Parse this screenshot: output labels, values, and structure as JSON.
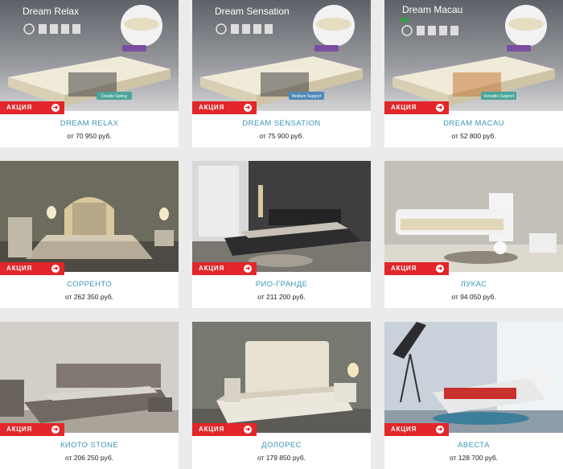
{
  "badge_label": "АКЦИЯ",
  "badge_arrow": "➜",
  "products": [
    {
      "name": "DREAM RELAX",
      "price": "от 70 950 руб.",
      "image_caption": "Dream Relax",
      "image_tag": "Double Spring"
    },
    {
      "name": "DREAM SENSATION",
      "price": "от 75 900 руб.",
      "image_caption": "Dream Sensation",
      "image_tag": "Medium Support"
    },
    {
      "name": "DREAM MACAU",
      "price": "от 52 800 руб.",
      "image_caption": "Dream Macau",
      "image_tag": "Versatile Support"
    },
    {
      "name": "СОРРЕНТО",
      "price": "от 262 350 руб."
    },
    {
      "name": "РИО-ГРАНДЕ",
      "price": "от 211 200 руб."
    },
    {
      "name": "ЛУКАС",
      "price": "от 94 050 руб."
    },
    {
      "name": "КИОТО STONE",
      "price": "от 206 250 руб."
    },
    {
      "name": "ДОЛОРЕС",
      "price": "от 179 850 руб."
    },
    {
      "name": "АВЕСТА",
      "price": "от 128 700 руб."
    }
  ],
  "colors": {
    "accent": "#e2262a",
    "name": "#3c97b8",
    "background": "#ebebeb"
  },
  "icons": {
    "badge_arrow": "arrow-right-icon"
  }
}
